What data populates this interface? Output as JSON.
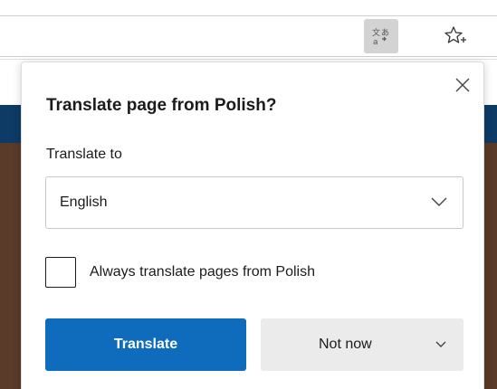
{
  "toolbar": {
    "translate_icon": "translate-icon",
    "favorite_icon": "star-add-icon"
  },
  "flyout": {
    "title": "Translate page from Polish?",
    "close_icon": "close-icon",
    "translate_to_label": "Translate to",
    "language_select": {
      "value": "English",
      "icon": "chevron-down-icon"
    },
    "always_checkbox": {
      "checked": false,
      "label": "Always translate pages from Polish"
    },
    "translate_button": "Translate",
    "not_now_button": "Not now",
    "not_now_dropdown_icon": "chevron-down-icon"
  },
  "colors": {
    "primary": "#0f6cbd",
    "secondary_button": "#ebebeb",
    "active_toolbar_button": "#d3d3d3"
  }
}
